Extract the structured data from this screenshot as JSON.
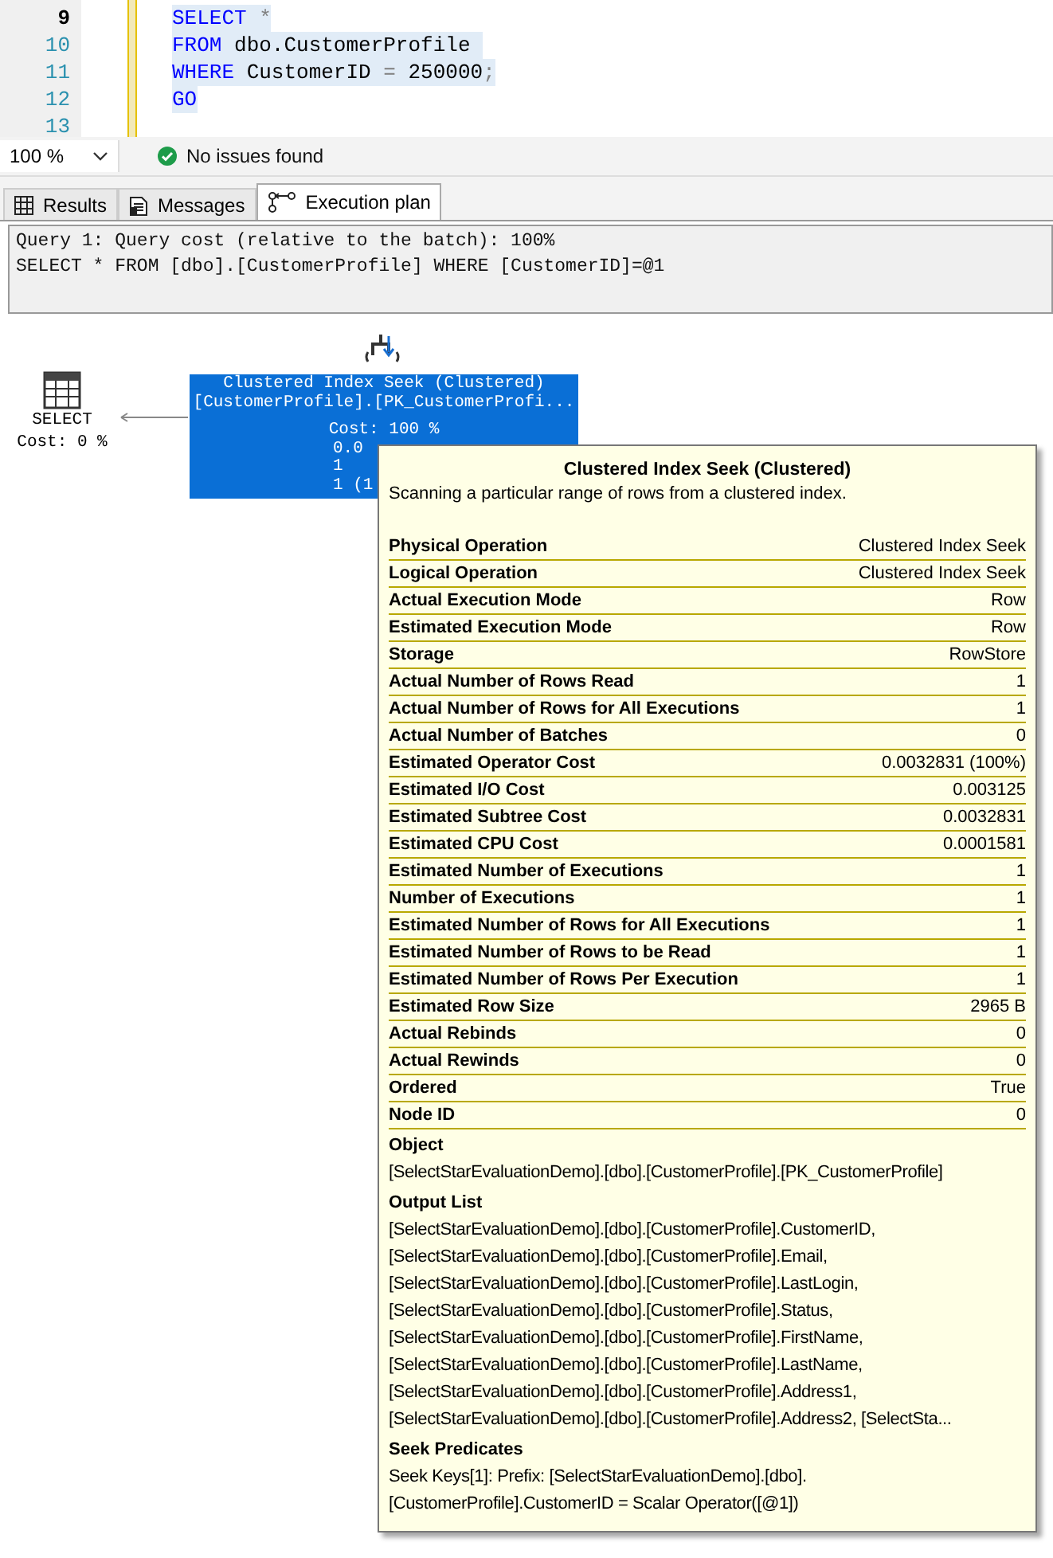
{
  "editor": {
    "lines": [
      {
        "number": "9",
        "code": [
          {
            "t": "SELECT",
            "kind": "keyword"
          },
          {
            "t": " *",
            "kind": "op"
          }
        ],
        "current": true
      },
      {
        "number": "10",
        "code": [
          {
            "t": "FROM",
            "kind": "keyword"
          },
          {
            "t": " dbo.CustomerProfile ",
            "kind": "plain"
          }
        ],
        "current": false
      },
      {
        "number": "11",
        "code": [
          {
            "t": "WHERE",
            "kind": "keyword"
          },
          {
            "t": " CustomerID ",
            "kind": "plain"
          },
          {
            "t": "=",
            "kind": "op"
          },
          {
            "t": " 250000",
            "kind": "plain"
          },
          {
            "t": ";",
            "kind": "op"
          }
        ],
        "current": false
      },
      {
        "number": "12",
        "code": [
          {
            "t": "GO",
            "kind": "keyword"
          }
        ],
        "current": false
      },
      {
        "number": "13",
        "current": false
      }
    ]
  },
  "status_bar": {
    "zoom": "100 %",
    "issues": "No issues found"
  },
  "tabs": [
    {
      "label": "Results",
      "selected": false
    },
    {
      "label": "Messages",
      "selected": false
    },
    {
      "label": "Execution plan",
      "selected": true
    }
  ],
  "query_header": [
    "Query 1: Query cost (relative to the batch): 100%",
    "SELECT * FROM [dbo].[CustomerProfile] WHERE [CustomerID]=@1"
  ],
  "plan": {
    "select_node": {
      "label": "SELECT",
      "cost": "Cost: 0 %"
    },
    "seek_node": {
      "title": "Clustered Index Seek (Clustered)",
      "object": "[CustomerProfile].[PK_CustomerProfi...",
      "cost": "Cost: 100 %",
      "covered_lines": [
        "0.0",
        "1",
        "1 (1"
      ],
      "selected": true
    }
  },
  "tooltip": {
    "title": "Clustered Index Seek (Clustered)",
    "description": "Scanning a particular range of rows from a clustered index.",
    "properties": [
      {
        "name": "Physical Operation",
        "value": "Clustered Index Seek"
      },
      {
        "name": "Logical Operation",
        "value": "Clustered Index Seek"
      },
      {
        "name": "Actual Execution Mode",
        "value": "Row"
      },
      {
        "name": "Estimated Execution Mode",
        "value": "Row"
      },
      {
        "name": "Storage",
        "value": "RowStore"
      },
      {
        "name": "Actual Number of Rows Read",
        "value": "1"
      },
      {
        "name": "Actual Number of Rows for All Executions",
        "value": "1"
      },
      {
        "name": "Actual Number of Batches",
        "value": "0"
      },
      {
        "name": "Estimated Operator Cost",
        "value": "0.0032831 (100%)"
      },
      {
        "name": "Estimated I/O Cost",
        "value": "0.003125"
      },
      {
        "name": "Estimated Subtree Cost",
        "value": "0.0032831"
      },
      {
        "name": "Estimated CPU Cost",
        "value": "0.0001581"
      },
      {
        "name": "Estimated Number of Executions",
        "value": "1"
      },
      {
        "name": "Number of Executions",
        "value": "1"
      },
      {
        "name": "Estimated Number of Rows for All Executions",
        "value": "1"
      },
      {
        "name": "Estimated Number of Rows to be Read",
        "value": "1"
      },
      {
        "name": "Estimated Number of Rows Per Execution",
        "value": "1"
      },
      {
        "name": "Estimated Row Size",
        "value": "2965 B"
      },
      {
        "name": "Actual Rebinds",
        "value": "0"
      },
      {
        "name": "Actual Rewinds",
        "value": "0"
      },
      {
        "name": "Ordered",
        "value": "True"
      },
      {
        "name": "Node ID",
        "value": "0"
      }
    ],
    "sections": [
      {
        "heading": "Object",
        "lines": [
          "[SelectStarEvaluationDemo].[dbo].[CustomerProfile].[PK_CustomerProfile]"
        ]
      },
      {
        "heading": "Output List",
        "lines": [
          "[SelectStarEvaluationDemo].[dbo].[CustomerProfile].CustomerID,",
          "[SelectStarEvaluationDemo].[dbo].[CustomerProfile].Email,",
          "[SelectStarEvaluationDemo].[dbo].[CustomerProfile].LastLogin,",
          "[SelectStarEvaluationDemo].[dbo].[CustomerProfile].Status,",
          "[SelectStarEvaluationDemo].[dbo].[CustomerProfile].FirstName,",
          "[SelectStarEvaluationDemo].[dbo].[CustomerProfile].LastName,",
          "[SelectStarEvaluationDemo].[dbo].[CustomerProfile].Address1,",
          "[SelectStarEvaluationDemo].[dbo].[CustomerProfile].Address2, [SelectSta..."
        ]
      },
      {
        "heading": "Seek Predicates",
        "lines": [
          "Seek Keys[1]: Prefix: [SelectStarEvaluationDemo].[dbo].",
          "[CustomerProfile].CustomerID = Scalar Operator([@1])"
        ]
      }
    ]
  }
}
